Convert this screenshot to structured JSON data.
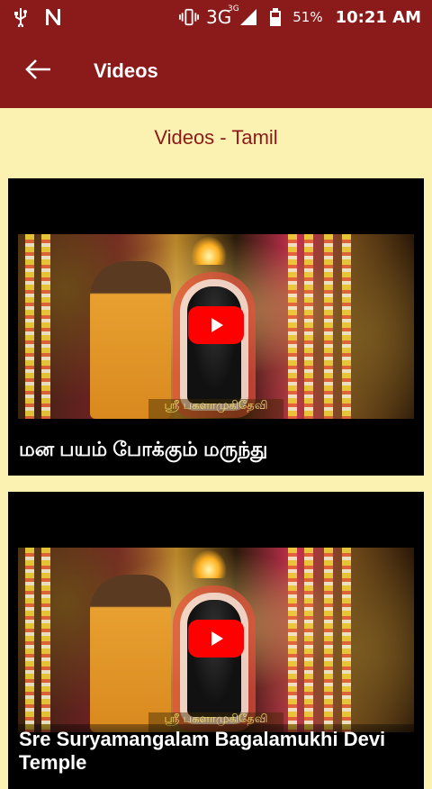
{
  "status_bar": {
    "network": "3G",
    "network_sup": "3G",
    "battery_percent": "51%",
    "time": "10:21 AM",
    "icons": [
      "usb-icon",
      "n-notification-icon",
      "vibrate-icon",
      "signal-icon",
      "battery-icon"
    ]
  },
  "app_bar": {
    "title": "Videos",
    "back_icon": "arrow-left-icon"
  },
  "section": {
    "title": "Videos - Tamil"
  },
  "videos": [
    {
      "title": "மன பயம் போக்கும் மருந்து",
      "caption": "ஸ்ரீ பகளாமுகிதேவி"
    },
    {
      "title": "Sre Suryamangalam Bagalamukhi Devi Temple",
      "caption": "ஸ்ரீ பகளாமுகிதேவி"
    }
  ],
  "colors": {
    "primary": "#8b1a1a",
    "background": "#fbf1b0",
    "play_button": "#ff0000"
  }
}
